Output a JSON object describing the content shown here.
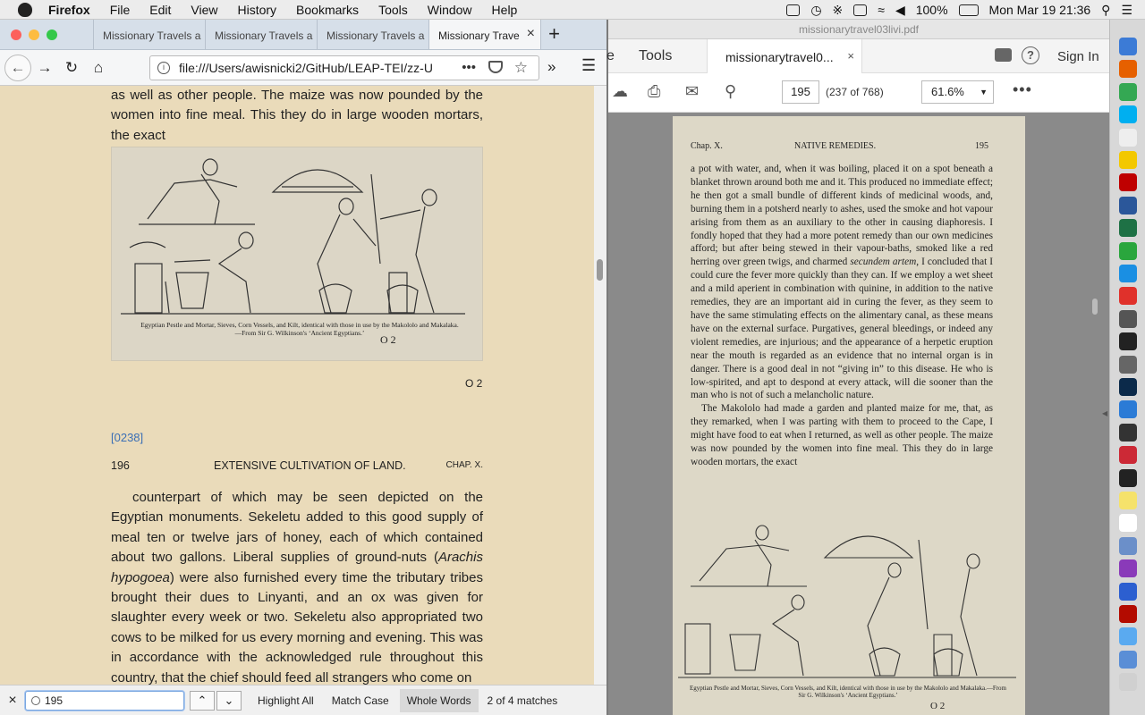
{
  "menubar": {
    "app_name": "Firefox",
    "items": [
      "File",
      "Edit",
      "View",
      "History",
      "Bookmarks",
      "Tools",
      "Window",
      "Help"
    ],
    "battery": "100%",
    "datetime": "Mon Mar 19  21:36"
  },
  "firefox": {
    "tabs": [
      {
        "label": "Missionary Travels a"
      },
      {
        "label": "Missionary Travels a"
      },
      {
        "label": "Missionary Travels a"
      },
      {
        "label": "Missionary Trave"
      }
    ],
    "url": "file:///Users/awisnicki2/GitHub/LEAP-TEI/zz-U",
    "content": {
      "para_top": "as well as other people. The maize was now pounded by the women into fine meal. This they do in large wooden mortars, the exact",
      "figure_caption": "Egyptian Pestle and Mortar, Sieves, Corn Vessels, and Kilt, identical with those in use by the Makololo and Makalaka.—From Sir G. Wilkinson's ‘Ancient Egyptians.’",
      "figure_signature": "O 2",
      "page_sig": "O 2",
      "page_id": "[0238]",
      "running_head": {
        "page": "196",
        "center": "EXTENSIVE CULTIVATION OF LAND.",
        "chapter": "CHAP. X."
      },
      "para_main_1": "counterpart of which may be seen depicted on the Egyptian monuments. Sekeletu added to this good supply of meal ten or twelve jars of honey, each of which contained about two gallons. Liberal supplies of ground-nuts (",
      "para_main_italic": "Arachis hypogoea",
      "para_main_2": ") were also furnished every time the tributary tribes brought their dues to Linyanti, and an ox was given for slaughter every week or two. Sekeletu also appropriated two cows to be milked for us every morning and evening. This was in accordance with the acknowledged rule throughout this country, that the chief should feed all strangers who come on"
    },
    "findbar": {
      "query": "195",
      "highlight_all": "Highlight All",
      "match_case": "Match Case",
      "whole_words": "Whole Words",
      "count": "2 of 4 matches"
    }
  },
  "pdf": {
    "window_title": "missionarytravel03livi.pdf",
    "tools_label": "Tools",
    "doc_tab": "missionarytravel0...",
    "sign_in": "Sign In",
    "page_input": "195",
    "page_of": "(237 of 768)",
    "zoom": "61.6%",
    "page": {
      "head_left": "Chap. X.",
      "head_center": "NATIVE REMEDIES.",
      "head_right": "195",
      "text_1": "a pot with water, and, when it was boiling, placed it on a spot beneath a blanket thrown around both me and it. This produced no immediate effect; he then got a small bundle of different kinds of medicinal woods, and, burning them in a potsherd nearly to ashes, used the smoke and hot vapour arising from them as an auxiliary to the other in causing diaphoresis. I fondly hoped that they had a more potent remedy than our own medicines afford; but after being stewed in their vapour-baths, smoked like a red herring over green twigs, and charmed ",
      "text_1_italic": "secundem artem",
      "text_1b": ", I concluded that I could cure the fever more quickly than they can. If we employ a wet sheet and a mild aperient in combination with quinine, in addition to the native remedies, they are an important aid in curing the fever, as they seem to have the same stimulating effects on the alimentary canal, as these means have on the external surface. Purgatives, general bleedings, or indeed any violent remedies, are injurious; and the appearance of a herpetic eruption near the mouth is regarded as an evidence that no internal organ is in danger. There is a good deal in not “giving in” to this disease. He who is low-spirited, and apt to despond at every attack, will die sooner than the man who is not of such a melancholic nature.",
      "text_2": "The Makololo had made a garden and planted maize for me, that, as they remarked, when I was parting with them to proceed to the Cape, I might have food to eat when I returned, as well as other people. The maize was now pounded by the women into fine meal. This they do in large wooden mortars, the exact",
      "caption": "Egyptian Pestle and Mortar, Sieves, Corn Vessels, and Kilt, identical with those in use by the Makololo and Makalaka.—From Sir G. Wilkinson's ‘Ancient Egyptians.’",
      "signature": "O 2"
    }
  },
  "dock": {
    "apps": [
      {
        "name": "finder",
        "color": "#3c7bd6"
      },
      {
        "name": "firefox",
        "color": "#e66000"
      },
      {
        "name": "chrome",
        "color": "#34a853"
      },
      {
        "name": "skype",
        "color": "#00aff0"
      },
      {
        "name": "textedit",
        "color": "#eeeeee"
      },
      {
        "name": "sublime",
        "color": "#f3c800"
      },
      {
        "name": "filezilla",
        "color": "#bf0000"
      },
      {
        "name": "word",
        "color": "#2b579a"
      },
      {
        "name": "excel",
        "color": "#1e7145"
      },
      {
        "name": "sync",
        "color": "#2aa63d"
      },
      {
        "name": "safari",
        "color": "#1a8fe3"
      },
      {
        "name": "acrobat-red",
        "color": "#e0312b"
      },
      {
        "name": "pen-tool",
        "color": "#555555"
      },
      {
        "name": "terminal",
        "color": "#222222"
      },
      {
        "name": "camera",
        "color": "#666666"
      },
      {
        "name": "photoshop",
        "color": "#0b2a4a"
      },
      {
        "name": "sourcetree",
        "color": "#2b7bd6"
      },
      {
        "name": "clock",
        "color": "#333333"
      },
      {
        "name": "zotero",
        "color": "#cc2936"
      },
      {
        "name": "github",
        "color": "#222222"
      },
      {
        "name": "notes",
        "color": "#f5e26b"
      },
      {
        "name": "calendar",
        "color": "#ffffff"
      },
      {
        "name": "preview",
        "color": "#6b8fc9"
      },
      {
        "name": "podcast",
        "color": "#8a3ab9"
      },
      {
        "name": "x-app",
        "color": "#2c5fd0"
      },
      {
        "name": "acrobat",
        "color": "#b30b00"
      },
      {
        "name": "folder",
        "color": "#5aaaf0"
      },
      {
        "name": "downloads",
        "color": "#5a8ed6"
      },
      {
        "name": "trash",
        "color": "#d0d0d0"
      }
    ]
  }
}
